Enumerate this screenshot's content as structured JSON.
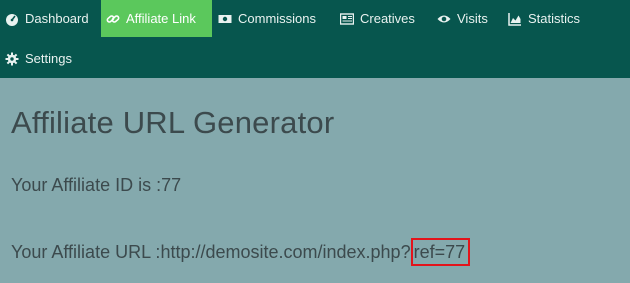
{
  "nav": {
    "items": [
      {
        "label": "Dashboard",
        "icon": "dashboard-icon",
        "active": false
      },
      {
        "label": "Affiliate Link",
        "icon": "link-icon",
        "active": true
      },
      {
        "label": "Commissions",
        "icon": "money-icon",
        "active": false
      },
      {
        "label": "Creatives",
        "icon": "newspaper-icon",
        "active": false
      },
      {
        "label": "Visits",
        "icon": "eye-icon",
        "active": false
      },
      {
        "label": "Statistics",
        "icon": "chart-icon",
        "active": false
      },
      {
        "label": "Settings",
        "icon": "gear-icon",
        "active": false
      }
    ]
  },
  "main": {
    "title": "Affiliate URL Generator",
    "affiliate_id_label": "Your Affiliate ID is :",
    "affiliate_id": "77",
    "affiliate_url_label": "Your Affiliate URL :",
    "affiliate_url_base": "http://demosite.com/index.php?",
    "affiliate_url_ref": "ref=77"
  },
  "colors": {
    "nav_background": "#07564e",
    "active_tab": "#5bc85c",
    "page_background": "#84a9ad",
    "highlight_box": "#e3141b"
  }
}
